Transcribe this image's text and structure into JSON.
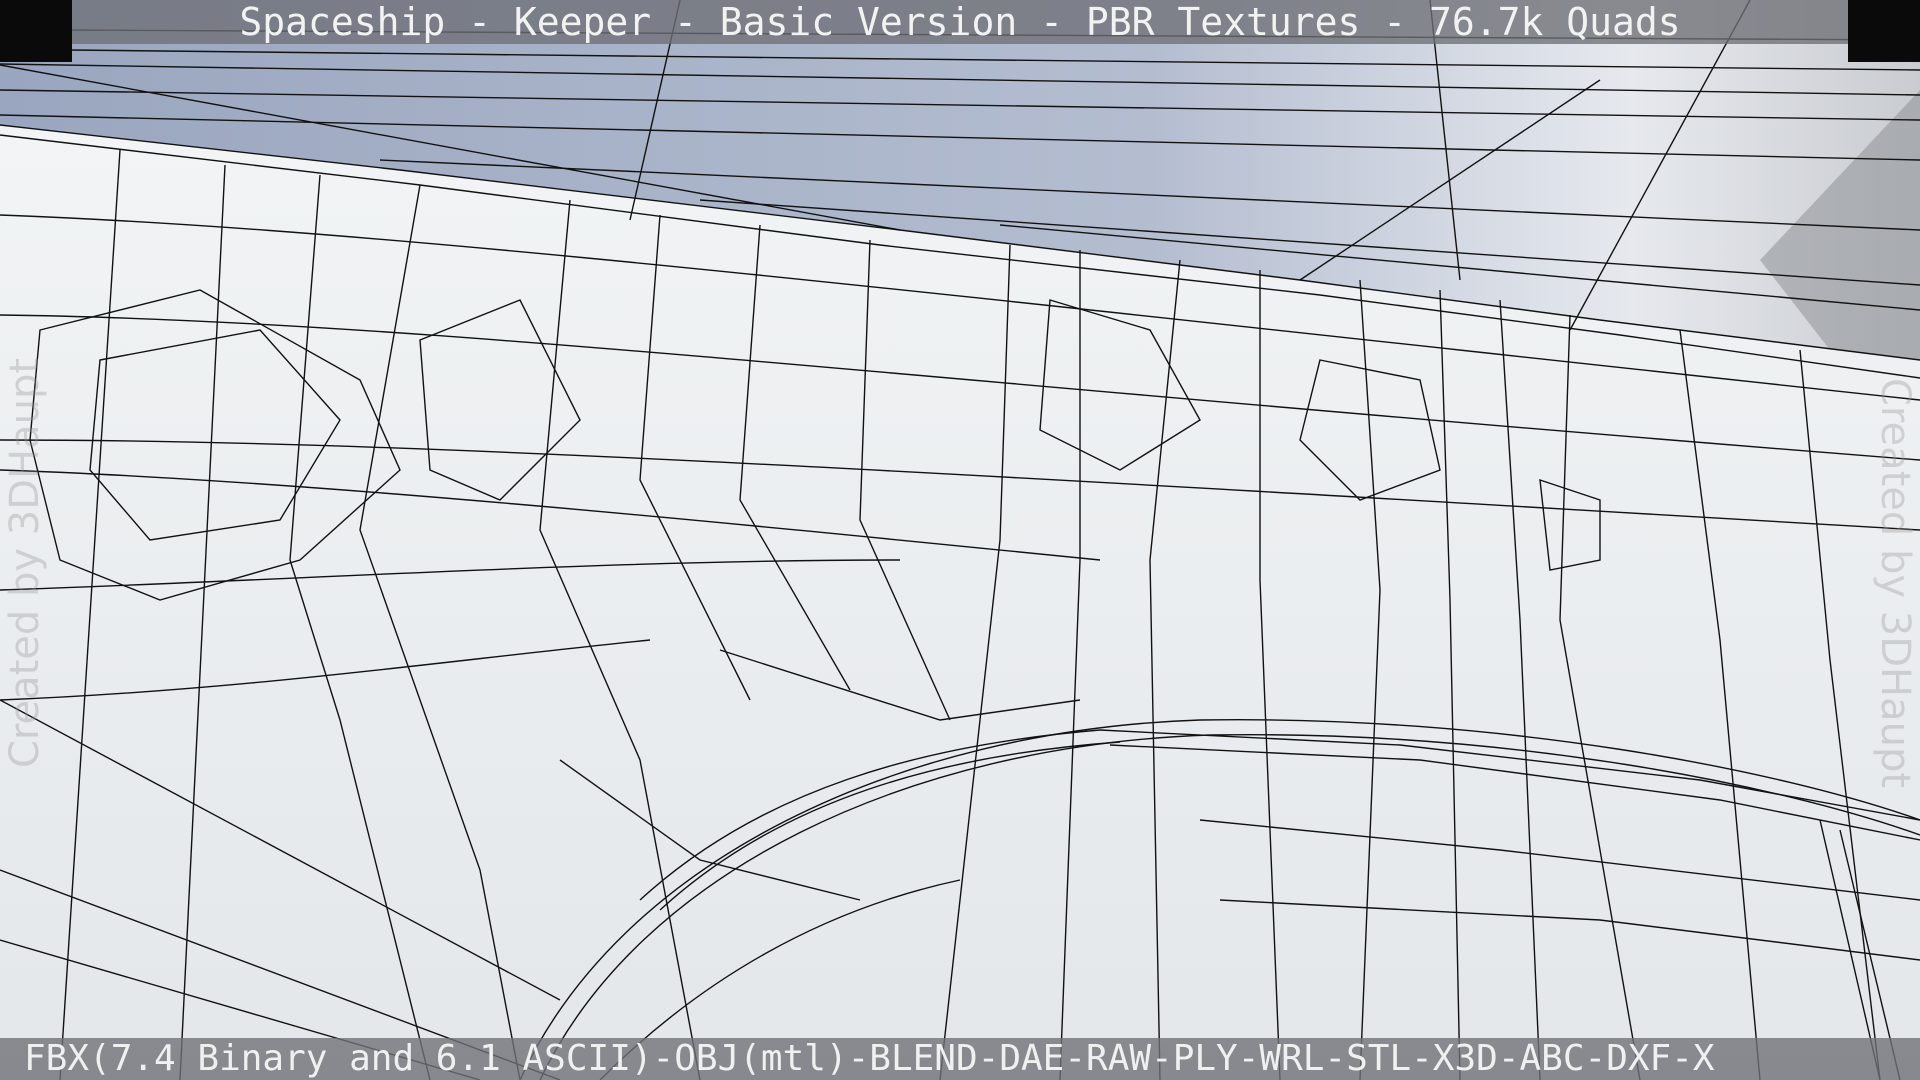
{
  "title": "Spaceship - Keeper - Basic Version - PBR Textures - 76.7k Quads",
  "formats": "FBX(7.4 Binary and 6.1 ASCII)-OBJ(mtl)-BLEND-DAE-RAW-PLY-WRL-STL-X3D-ABC-DXF-X",
  "watermark": "Created by 3DHaupt",
  "colors": {
    "sky": "#a3adc4",
    "hull": "#eef0f2",
    "wire": "#111111",
    "bar": "#6f7278"
  }
}
